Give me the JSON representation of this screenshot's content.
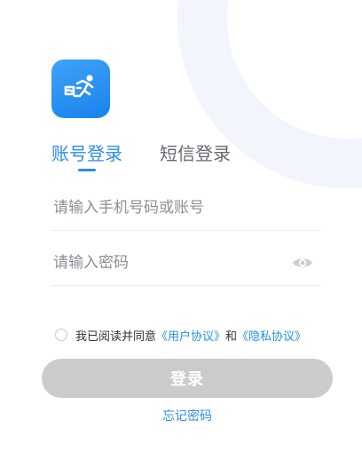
{
  "colors": {
    "accent": "#2b8ee8",
    "logo_bg": "#1e8cf0",
    "button_disabled": "#cbcbcb",
    "muted_text": "#666a70",
    "decor": "#f2f6fc"
  },
  "logo": {
    "icon": "delivery-runner-icon"
  },
  "tabs": {
    "password_login": "账号登录",
    "sms_login": "短信登录",
    "active": "password_login"
  },
  "form": {
    "account_placeholder": "请输入手机号码或账号",
    "account_value": "",
    "password_placeholder": "请输入密码",
    "password_value": "",
    "password_toggle_icon": "eye-icon"
  },
  "agreement": {
    "checked": false,
    "prefix": "我已阅读并同意",
    "user_agreement": "《用户协议》",
    "and": "和",
    "privacy_policy": "《隐私协议》"
  },
  "login_button": "登录",
  "forgot_password": "忘记密码"
}
